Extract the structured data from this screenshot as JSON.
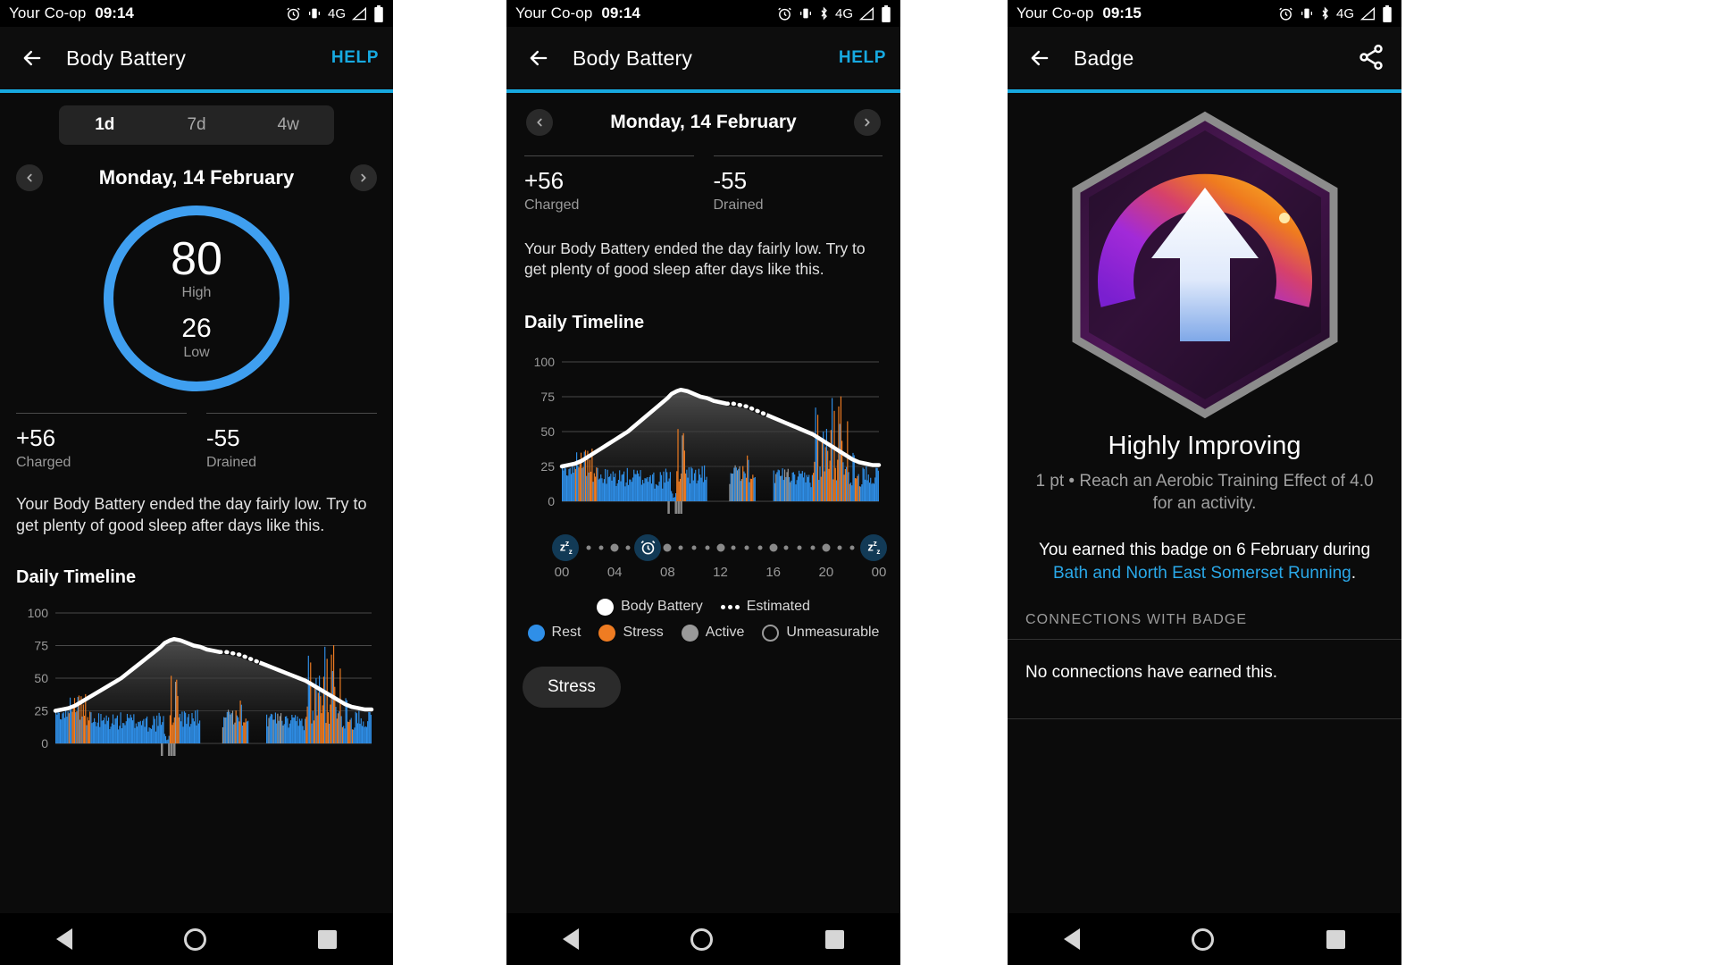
{
  "statusbar": {
    "carrier": "Your Co-op",
    "time_1": "09:14",
    "time_2": "09:14",
    "time_3": "09:15",
    "network": "4G",
    "icons": [
      "alarm-icon",
      "vibrate-icon",
      "signal-icon",
      "battery-icon"
    ]
  },
  "panel1": {
    "appbar": {
      "title": "Body Battery",
      "action": "HELP",
      "back": "back-arrow-icon"
    },
    "tabs": [
      {
        "label": "1d",
        "active": true
      },
      {
        "label": "7d",
        "active": false
      },
      {
        "label": "4w",
        "active": false
      }
    ],
    "date": "Monday, 14 February",
    "ring": {
      "high_value": "80",
      "high_label": "High",
      "low_value": "26",
      "low_label": "Low",
      "color": "#3f9ff0"
    },
    "stats": [
      {
        "value": "+56",
        "label": "Charged"
      },
      {
        "value": "-55",
        "label": "Drained"
      }
    ],
    "summary": "Your Body Battery ended the day fairly low. Try to get plenty of good sleep after days like this.",
    "section_title": "Daily Timeline",
    "y_ticks": [
      "100",
      "75",
      "50"
    ]
  },
  "panel2": {
    "appbar": {
      "title": "Body Battery",
      "action": "HELP",
      "back": "back-arrow-icon"
    },
    "date": "Monday, 14 February",
    "stats": [
      {
        "value": "+56",
        "label": "Charged"
      },
      {
        "value": "-55",
        "label": "Drained"
      }
    ],
    "summary": "Your Body Battery ended the day fairly low. Try to get plenty of good sleep after days like this.",
    "section_title": "Daily Timeline",
    "timeline_markers": [
      {
        "type": "sleep",
        "icon": "sleep-zzz-icon",
        "hour": 0.3
      },
      {
        "type": "alarm",
        "icon": "alarm-clock-icon",
        "hour": 6.5
      },
      {
        "type": "sleep",
        "icon": "sleep-zzz-icon",
        "hour": 23.6
      }
    ],
    "legend_row1": [
      {
        "name": "Body Battery",
        "swatch": "solid",
        "color": "#ffffff"
      },
      {
        "name": "Estimated",
        "swatch": "dotted",
        "color": "#ffffff"
      }
    ],
    "legend_row2": [
      {
        "name": "Rest",
        "swatch": "solid",
        "color": "#2f8fe8"
      },
      {
        "name": "Stress",
        "swatch": "solid",
        "color": "#ef7c22"
      },
      {
        "name": "Active",
        "swatch": "solid",
        "color": "#9a9a9a"
      },
      {
        "name": "Unmeasurable",
        "swatch": "outline",
        "color": "#9a9a9a"
      }
    ],
    "stress_button": "Stress"
  },
  "panel3": {
    "appbar": {
      "title": "Badge",
      "back": "back-arrow-icon",
      "share": "share-icon"
    },
    "badge_name": "Highly Improving",
    "badge_requirement": "1 pt • Reach an Aerobic Training Effect of 4.0 for an activity.",
    "earned_prefix": "You earned this badge on 6 February during",
    "earned_link": "Bath and North East Somerset Running",
    "earned_suffix": ".",
    "connections_header": "CONNECTIONS WITH BADGE",
    "connections_body": "No connections have earned this."
  },
  "navbar": {
    "back": "nav-back-triangle-icon",
    "home": "nav-home-circle-icon",
    "recents": "nav-recents-square-icon"
  },
  "colors": {
    "accent": "#17a9e0",
    "rest": "#2f8fe8",
    "stress": "#ef7c22",
    "active": "#9a9a9a",
    "body_battery_line": "#ffffff",
    "background": "#0b0b0b"
  },
  "chart_data": {
    "type": "area",
    "title": "Daily Timeline",
    "xlabel": "",
    "ylabel": "",
    "ylim": [
      0,
      100
    ],
    "xlim": [
      0,
      24
    ],
    "y_ticks": [
      0,
      25,
      50,
      75,
      100
    ],
    "x_ticks": [
      0,
      4,
      8,
      12,
      16,
      20,
      24
    ],
    "x_tick_labels": [
      "00",
      "04",
      "08",
      "12",
      "16",
      "20",
      "00"
    ],
    "grid": true,
    "legend": [
      "Body Battery",
      "Estimated",
      "Rest",
      "Stress",
      "Active",
      "Unmeasurable"
    ],
    "series": [
      {
        "name": "Body Battery",
        "type": "line",
        "color": "#ffffff",
        "x": [
          0,
          0.5,
          1,
          1.5,
          2,
          2.5,
          3,
          3.5,
          4,
          4.5,
          5,
          5.5,
          6,
          6.5,
          7,
          7.5,
          8,
          8.3,
          8.7,
          9,
          9.5,
          10,
          10.5,
          11,
          11.5,
          12,
          12.5,
          13,
          13.5,
          14,
          14.5,
          15,
          15.5,
          16,
          16.5,
          17,
          17.5,
          18,
          18.5,
          19,
          19.5,
          20,
          20.5,
          21,
          21.5,
          22,
          22.5,
          23,
          23.5,
          24
        ],
        "y": [
          25,
          26,
          27,
          29,
          32,
          35,
          38,
          41,
          44,
          47,
          50,
          54,
          58,
          62,
          66,
          70,
          74,
          77,
          79,
          80,
          79,
          77,
          75,
          74,
          72,
          71,
          70,
          70,
          69,
          68,
          66,
          64,
          62,
          60,
          58,
          56,
          54,
          52,
          50,
          48,
          45,
          42,
          39,
          36,
          33,
          30,
          28,
          27,
          26,
          26
        ]
      },
      {
        "name": "Estimated",
        "type": "dotted-line",
        "color": "#ffffff",
        "segments": [
          [
            8.4,
            8.9
          ],
          [
            12.2,
            15.5
          ]
        ]
      },
      {
        "name": "Rest",
        "type": "bar",
        "color": "#2f8fe8",
        "note": "blue stress-level bars, mostly 00:00-11:00 and scattered later, values 3-27"
      },
      {
        "name": "Stress",
        "type": "bar",
        "color": "#ef7c22",
        "note": "orange spikes at ~01:00-02:30 (to 35), ~08:30-09:30 (to 50), ~13:00-14:00 (to 30), ~19:30-21:30 (to 75)"
      },
      {
        "name": "Active",
        "type": "bar",
        "color": "#9a9a9a",
        "note": "grey bars near 08:00-09:00 and 16:00-17:00"
      }
    ]
  }
}
